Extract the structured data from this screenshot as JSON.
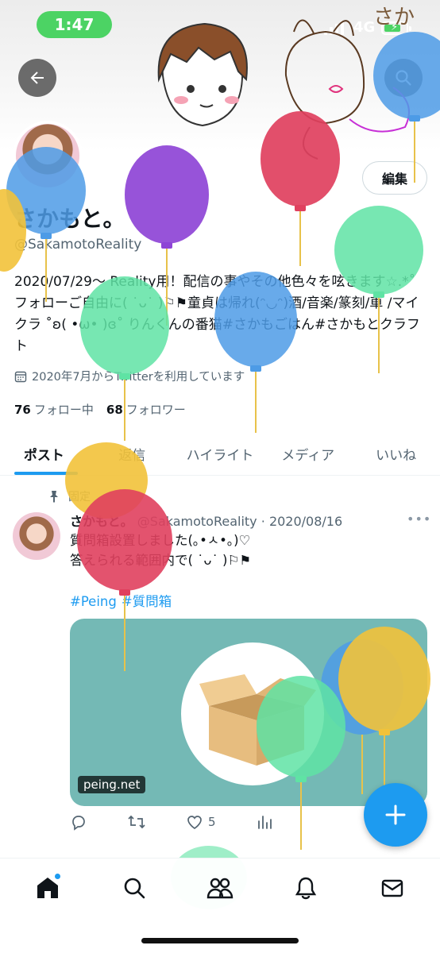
{
  "status_bar": {
    "time": "1:47",
    "network": "4G"
  },
  "colors": {
    "accent": "#1d9bf0",
    "time_pill": "#4cd364",
    "card_bg": "#74b9b5",
    "text_secondary": "#536471"
  },
  "profile": {
    "edit_label": "編集",
    "display_name": "さかもと。",
    "handle": "@SakamotoReality",
    "bio": "2020/07/29～ Reality用！配信の事やその他色々を呟きます☆.*˚フォローご自由に( ˙ᴗ˙ )⚐⚑童貞は帰れ(ᵔ◡ᵔ)酒/音楽/篆刻/車 /マイクラ ˚ʚ( •ω• )ɞ˚ りんくんの番猫#さかもごはん#さかもとクラフト",
    "joined": "2020年7月からTwitterを利用しています",
    "following_count": "76",
    "following_label": "フォロー中",
    "followers_count": "68",
    "followers_label": "フォロワー"
  },
  "tabs": [
    {
      "label": "ポスト",
      "active": true
    },
    {
      "label": "返信",
      "active": false
    },
    {
      "label": "ハイライト",
      "active": false
    },
    {
      "label": "メディア",
      "active": false
    },
    {
      "label": "いいね",
      "active": false
    }
  ],
  "tweet": {
    "pinned_label": "固定",
    "author": "さかもと。",
    "handle": "@SakamotoReality",
    "separator": "·",
    "date": "2020/08/16",
    "line1": "質問箱設置しました(｡•ㅅ•｡)♡",
    "line2": "答えられる範囲内で( ˙ᴗ˙ )⚐⚑",
    "hashtags": [
      "#Peing",
      "#質問箱"
    ],
    "card_url": "peing.net",
    "like_count": "5"
  },
  "nav": [
    "home-icon",
    "search-icon",
    "communities-icon",
    "notifications-icon",
    "messages-icon"
  ]
}
